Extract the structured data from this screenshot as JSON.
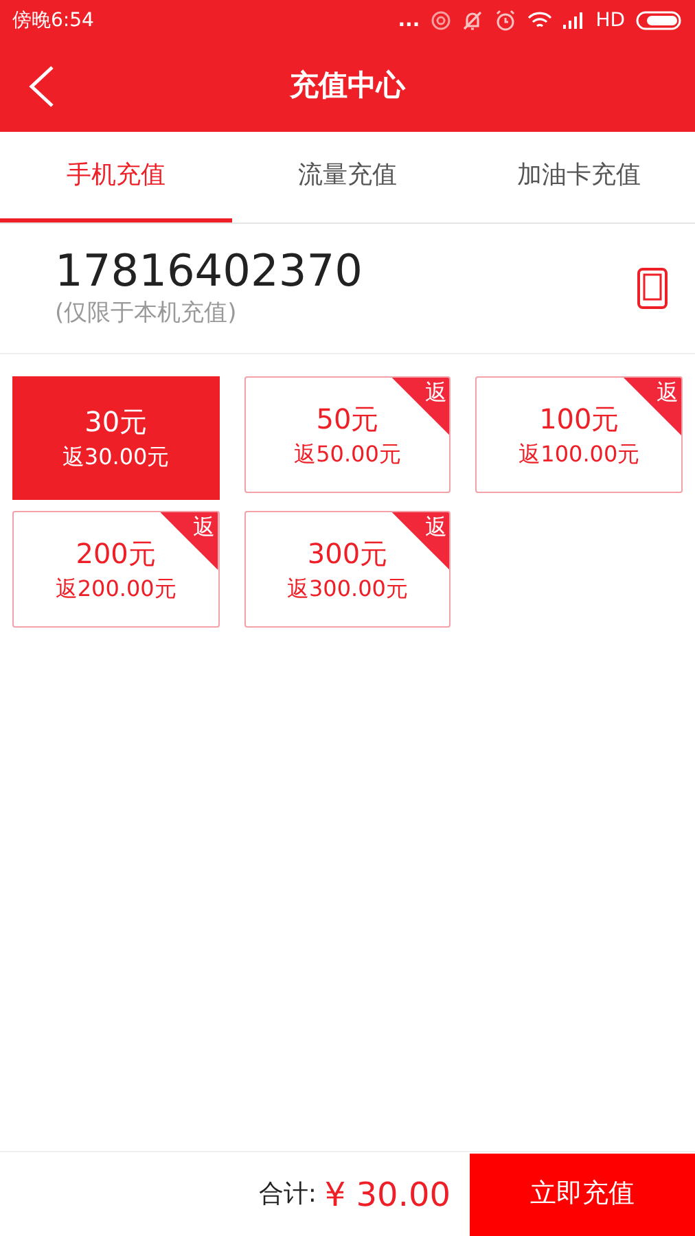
{
  "status_bar": {
    "time": "傍晚6:54",
    "dots": "...",
    "network": "HD"
  },
  "header": {
    "title": "充值中心"
  },
  "tabs": [
    {
      "label": "手机充值",
      "selected": true
    },
    {
      "label": "流量充值",
      "selected": false
    },
    {
      "label": "加油卡充值",
      "selected": false
    }
  ],
  "phone": {
    "number": "17816402370",
    "note": "(仅限于本机充值)"
  },
  "options": [
    {
      "amount": "30元",
      "rebate": "返30.00元",
      "selected": true
    },
    {
      "amount": "50元",
      "rebate": "返50.00元",
      "selected": false,
      "badge": "返"
    },
    {
      "amount": "100元",
      "rebate": "返100.00元",
      "selected": false,
      "badge": "返"
    },
    {
      "amount": "200元",
      "rebate": "返200.00元",
      "selected": false,
      "badge": "返"
    },
    {
      "amount": "300元",
      "rebate": "返300.00元",
      "selected": false,
      "badge": "返"
    }
  ],
  "footer": {
    "total_label": "合计:",
    "total": "¥ 30.00",
    "button": "立即充值"
  }
}
